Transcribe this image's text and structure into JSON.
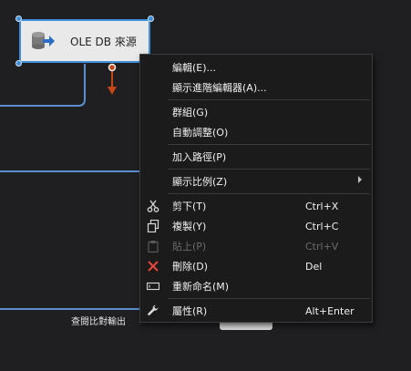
{
  "component": {
    "label": "OLE DB 來源",
    "icon": "database-source-icon"
  },
  "bottom_label": "查閱比對輸出",
  "menu": {
    "items": [
      {
        "label": "編輯(E)...",
        "shortcut": ""
      },
      {
        "label": "顯示進階編輯器(A)...",
        "shortcut": ""
      },
      {
        "label": "群組(G)",
        "shortcut": ""
      },
      {
        "label": "自動調整(O)",
        "shortcut": ""
      },
      {
        "label": "加入路徑(P)",
        "shortcut": ""
      },
      {
        "label": "顯示比例(Z)",
        "shortcut": ""
      },
      {
        "label": "剪下(T)",
        "shortcut": "Ctrl+X",
        "icon": "scissors-icon"
      },
      {
        "label": "複製(Y)",
        "shortcut": "Ctrl+C",
        "icon": "copy-icon"
      },
      {
        "label": "貼上(P)",
        "shortcut": "Ctrl+V",
        "icon": "paste-icon",
        "disabled": true
      },
      {
        "label": "刪除(D)",
        "shortcut": "Del",
        "icon": "delete-x-icon"
      },
      {
        "label": "重新命名(M)",
        "shortcut": "",
        "icon": "rename-icon"
      },
      {
        "label": "屬性(R)",
        "shortcut": "Alt+Enter",
        "icon": "wrench-icon"
      }
    ]
  },
  "colors": {
    "background": "#1f1f21",
    "selection": "#3f8fdc",
    "path_arrow": "#c84614",
    "connector": "#5b8fd0",
    "delete": "#e8473b"
  }
}
